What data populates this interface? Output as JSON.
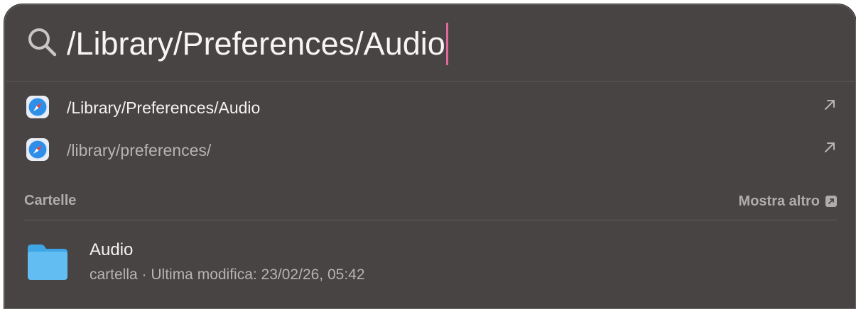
{
  "search": {
    "query": "/Library/Preferences/Audio",
    "caret_color": "#e0699b"
  },
  "suggestions": [
    {
      "label": "/Library/Preferences/Audio",
      "icon": "safari-icon",
      "action": "open-arrow-icon"
    },
    {
      "label": "/library/preferences/",
      "icon": "safari-icon",
      "action": "open-arrow-icon"
    }
  ],
  "section": {
    "title": "Cartelle",
    "show_more": "Mostra altro"
  },
  "results": [
    {
      "title": "Audio",
      "subtitle": "cartella · Ultima modifica: 23/02/26, 05:42",
      "icon": "folder-icon"
    }
  ],
  "colors": {
    "panel_bg": "#474443",
    "folder_blue": "#5ab8f0",
    "text_primary": "#f5f3f2",
    "text_secondary": "#b7b3b2"
  }
}
